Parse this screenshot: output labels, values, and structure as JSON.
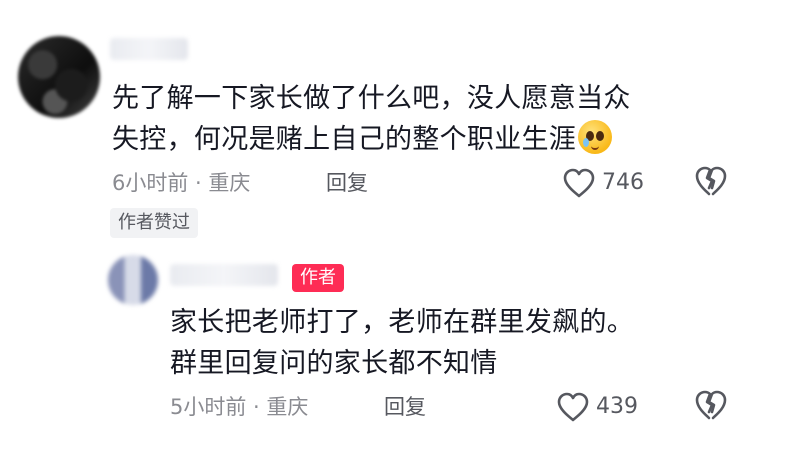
{
  "main_comment": {
    "text_line1": "先了解一下家长做了什么吧，没人愿意当众",
    "text_line2": "失控，何况是赌上自己的整个职业生涯",
    "emoji_icon": "pleading-face-emoji-icon",
    "meta": "6小时前 · 重庆",
    "reply_label": "回复",
    "like_count": "746",
    "liked_by_author_tag": "作者赞过"
  },
  "reply_comment": {
    "author_badge": "作者",
    "text_line1": "家长把老师打了，老师在群里发飙的。",
    "text_line2": "群里回复问的家长都不知情",
    "meta": "5小时前 · 重庆",
    "reply_label": "回复",
    "like_count": "439"
  },
  "colors": {
    "author_badge_bg": "#fe2c55",
    "text": "#161823",
    "meta": "#8a8b91",
    "icon": "#56585f"
  }
}
